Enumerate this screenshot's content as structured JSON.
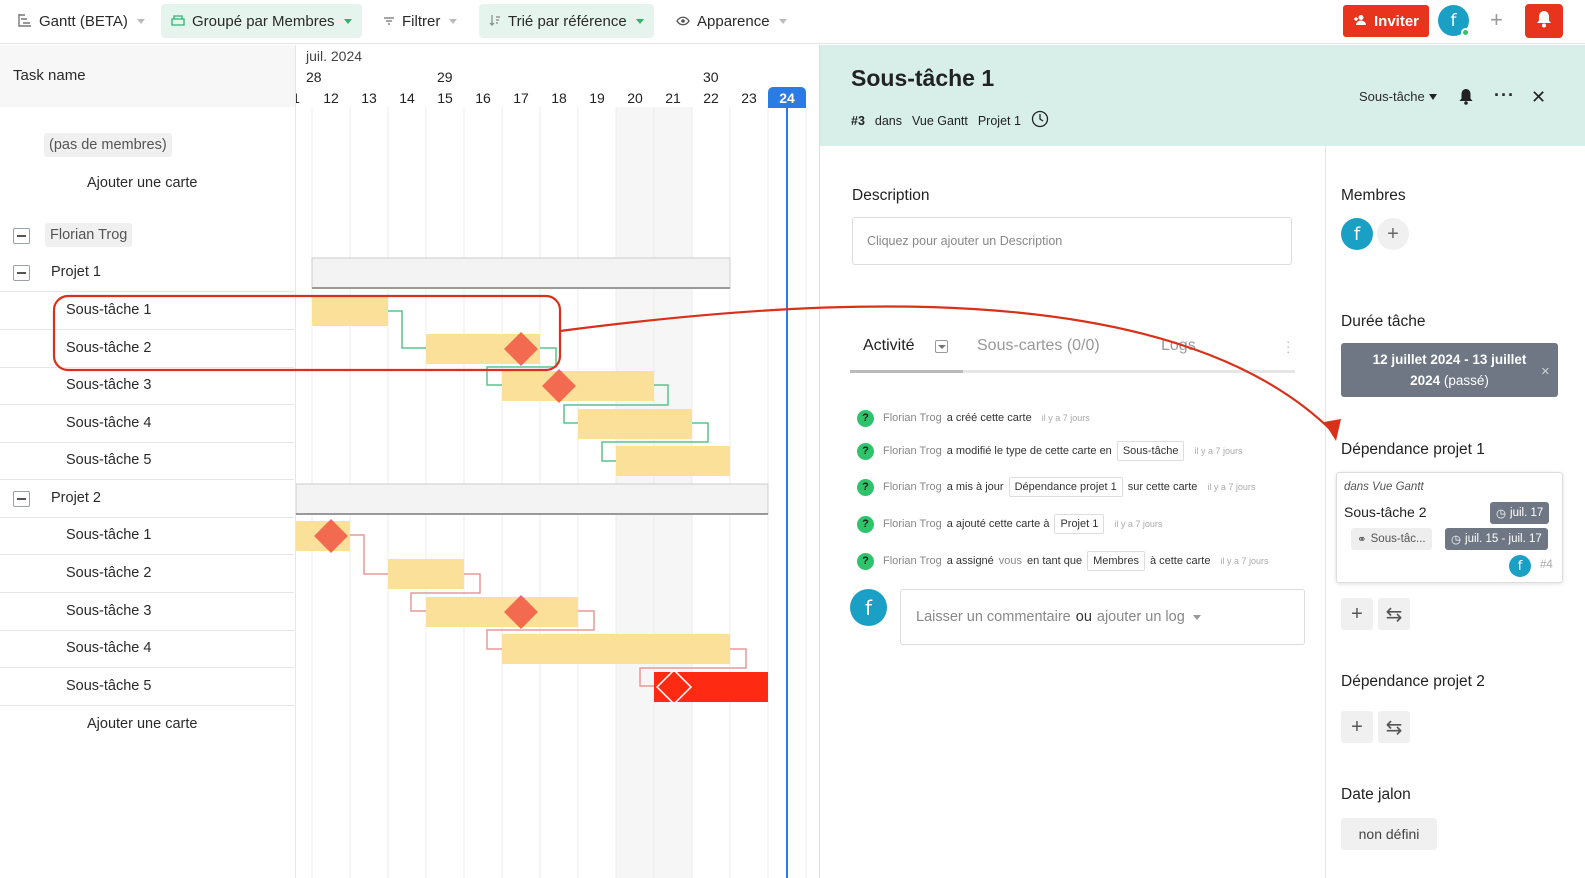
{
  "toolbar": {
    "view": "Gantt (BETA)",
    "group": "Groupé par Membres",
    "filter": "Filtrer",
    "sort": "Trié par référence",
    "appearance": "Apparence",
    "invite": "Inviter",
    "avatar_initial": "f",
    "accent": "#e8341c"
  },
  "gantt": {
    "task_header": "Task name",
    "month": "juil. 2024",
    "weeks": [
      "28",
      "29",
      "30"
    ],
    "days": [
      "1",
      "12",
      "13",
      "14",
      "15",
      "16",
      "17",
      "18",
      "19",
      "20",
      "21",
      "22",
      "23",
      "24"
    ],
    "today": "24",
    "no_members": "(pas de membres)",
    "add_card": "Ajouter une carte",
    "member": "Florian Trog",
    "projects": [
      {
        "name": "Projet 1",
        "tasks": [
          "Sous-tâche 1",
          "Sous-tâche 2",
          "Sous-tâche 3",
          "Sous-tâche 4",
          "Sous-tâche 5"
        ]
      },
      {
        "name": "Projet 2",
        "tasks": [
          "Sous-tâche 1",
          "Sous-tâche 2",
          "Sous-tâche 3",
          "Sous-tâche 4",
          "Sous-tâche 5"
        ]
      }
    ],
    "bar_color": "#fbe09a",
    "milestone_color": "#f26a4f",
    "overdue_color": "#ff2a12"
  },
  "panel": {
    "title": "Sous-tâche 1",
    "ref": "#3",
    "in": "dans",
    "view": "Vue Gantt",
    "project": "Projet 1",
    "type": "Sous-tâche",
    "description_label": "Description",
    "description_placeholder": "Cliquez pour ajouter un Description",
    "tabs": {
      "activity": "Activité",
      "subcards": "Sous-cartes (0/0)",
      "logs": "Logs"
    },
    "activities": [
      {
        "user": "Florian Trog",
        "pre": "a créé cette carte",
        "tag": "",
        "post": "",
        "ago": "il y a 7 jours"
      },
      {
        "user": "Florian Trog",
        "pre": "a modifié le type de cette carte en",
        "tag": "Sous-tâche",
        "post": "",
        "ago": "il y a 7 jours"
      },
      {
        "user": "Florian Trog",
        "pre": "a mis à jour",
        "tag": "Dépendance projet 1",
        "post": "sur cette carte",
        "ago": "il y a 7 jours"
      },
      {
        "user": "Florian Trog",
        "pre": "a ajouté cette carte à",
        "tag": "Projet 1",
        "post": "",
        "ago": "il y a 7 jours"
      },
      {
        "user": "Florian Trog",
        "pre": "a assigné",
        "pre2": "vous",
        "pre3": "en tant que",
        "tag": "Membres",
        "post": "à cette carte",
        "ago": "il y a 7 jours"
      }
    ],
    "comment": {
      "a": "Laisser un commentaire",
      "b": "ou",
      "c": "ajouter un log"
    },
    "members_label": "Membres",
    "duration_label": "Durée tâche",
    "duration_line1": "12 juillet 2024 - 13 juillet",
    "duration_line2": "2024",
    "duration_status": "(passé)",
    "dep1_label": "Dépendance projet 1",
    "dep1": {
      "where": "dans Vue Gantt",
      "name": "Sous-tâche 2",
      "date": "juil. 17",
      "link": "Sous-tâc...",
      "range": "juil. 15 - juil. 17",
      "number": "#4"
    },
    "dep2_label": "Dépendance projet 2",
    "milestone_label": "Date jalon",
    "milestone_value": "non défini",
    "header_color": "#d8efe9"
  }
}
